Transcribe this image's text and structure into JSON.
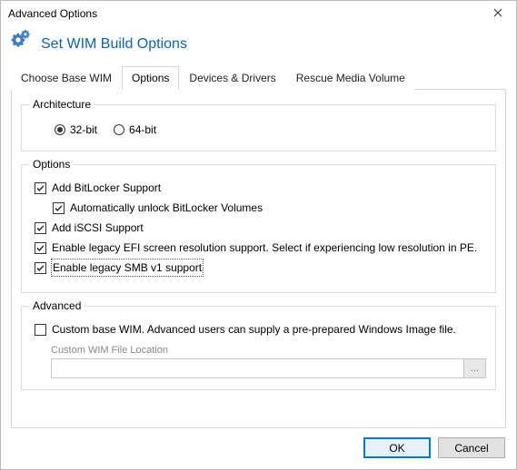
{
  "window": {
    "title": "Advanced Options"
  },
  "header": {
    "heading": "Set WIM Build Options"
  },
  "tabs": {
    "items": [
      {
        "label": "Choose Base WIM"
      },
      {
        "label": "Options"
      },
      {
        "label": "Devices & Drivers"
      },
      {
        "label": "Rescue Media Volume"
      }
    ],
    "activeIndex": 1
  },
  "architecture": {
    "legend": "Architecture",
    "options": [
      {
        "label": "32-bit",
        "checked": true
      },
      {
        "label": "64-bit",
        "checked": false
      }
    ]
  },
  "options": {
    "legend": "Options",
    "items": {
      "bitlocker": {
        "label": "Add BitLocker Support",
        "checked": true
      },
      "bitlocker_auto": {
        "label": "Automatically unlock BitLocker Volumes",
        "checked": true
      },
      "iscsi": {
        "label": "Add iSCSI Support",
        "checked": true
      },
      "efi": {
        "label": "Enable legacy EFI screen resolution support.  Select if experiencing low resolution in PE.",
        "checked": true
      },
      "smb": {
        "label": "Enable legacy SMB v1 support",
        "checked": true,
        "focused": true
      }
    }
  },
  "advanced": {
    "legend": "Advanced",
    "custom_wim": {
      "label": "Custom base WIM. Advanced users can supply a pre-prepared Windows Image file.",
      "checked": false
    },
    "location_label": "Custom WIM File Location",
    "location_value": "",
    "browse_label": "..."
  },
  "footer": {
    "ok": "OK",
    "cancel": "Cancel"
  }
}
